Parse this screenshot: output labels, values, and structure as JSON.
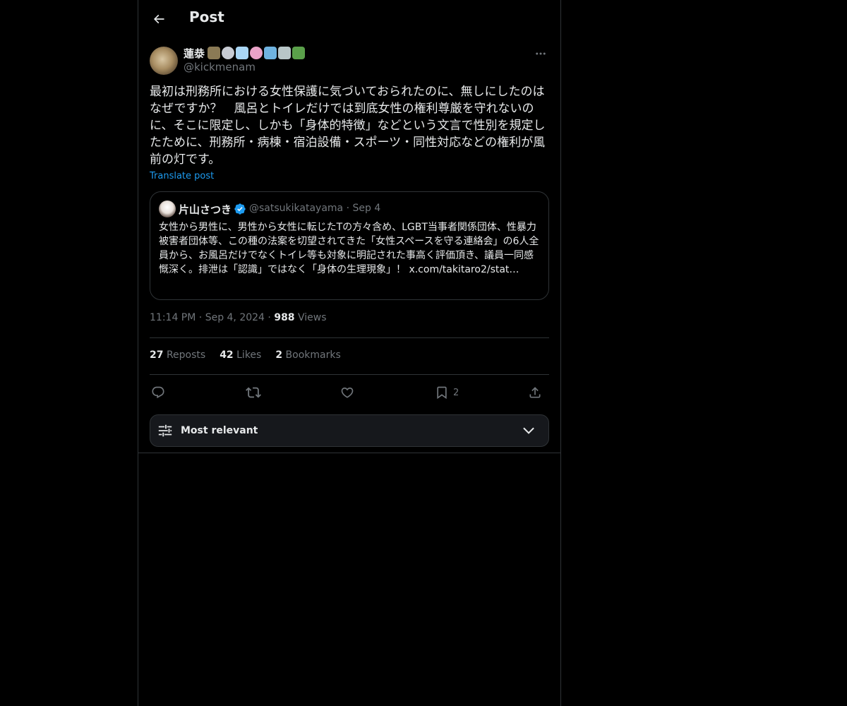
{
  "header": {
    "title": "Post"
  },
  "post": {
    "author_name": "蓮㳟",
    "author_handle": "@kickmenam",
    "text": "最初は刑務所における女性保護に気づいておられたのに、無しにしたのはなぜですか？　風呂とトイレだけでは到底女性の権利尊厳を守れないのに、そこに限定し、しかも「身体的特徴」などという文言で性別を規定したために、刑務所・病棟・宿泊設備・スポーツ・同性対応などの権利が風前の灯です。",
    "translate_label": "Translate post",
    "time": "11:14 PM",
    "date": "Sep 4, 2024",
    "views_count": "988",
    "views_label": "Views"
  },
  "quote": {
    "name": "片山さつき",
    "handle": "@satsukikatayama",
    "date": "Sep 4",
    "text": "女性から男性に、男性から女性に転じたTの方々含め、LGBT当事者関係団体、性暴力被害者団体等、この種の法案を切望されてきた「女性スペースを守る連絡会」の6人全員から、お風呂だけでなくトイレ等も対象に明記された事高く評価頂き、議員一同感慨深く。排泄は「認識」ではなく「身体の生理現象」！ x.com/takitaro2/stat…"
  },
  "stats": {
    "reposts_count": "27",
    "reposts_label": "Reposts",
    "likes_count": "42",
    "likes_label": "Likes",
    "bookmarks_count": "2",
    "bookmarks_label": "Bookmarks"
  },
  "actions": {
    "bookmark_count": "2"
  },
  "sort": {
    "label": "Most relevant"
  },
  "colors": {
    "accent": "#1d9bf0",
    "background": "#000000",
    "muted": "#71767b",
    "border": "#2f3336"
  },
  "icons": [
    "back-arrow-icon",
    "more-icon",
    "verified-icon",
    "reply-icon",
    "repost-icon",
    "like-icon",
    "bookmark-icon",
    "share-icon",
    "sliders-icon",
    "chevron-down-icon"
  ]
}
